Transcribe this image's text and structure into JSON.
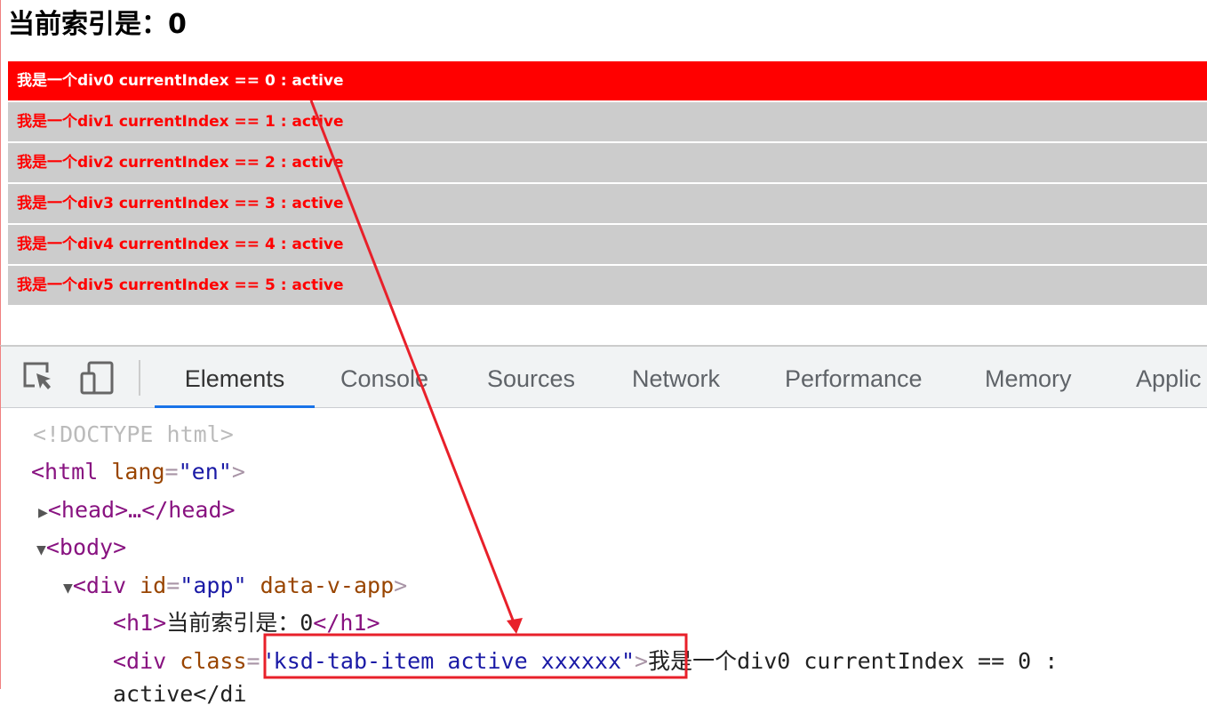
{
  "page": {
    "heading": "当前索引是：0",
    "items": [
      {
        "label": "我是一个div0 currentIndex == 0 : active",
        "active": true
      },
      {
        "label": "我是一个div1 currentIndex == 1 : active",
        "active": false
      },
      {
        "label": "我是一个div2 currentIndex == 2 : active",
        "active": false
      },
      {
        "label": "我是一个div3 currentIndex == 3 : active",
        "active": false
      },
      {
        "label": "我是一个div4 currentIndex == 4 : active",
        "active": false
      },
      {
        "label": "我是一个div5 currentIndex == 5 : active",
        "active": false
      }
    ]
  },
  "devtools": {
    "tools": [
      "inspect-element-icon",
      "device-toolbar-icon"
    ],
    "tabs": [
      "Elements",
      "Console",
      "Sources",
      "Network",
      "Performance",
      "Memory",
      "Applic"
    ],
    "selected_tab": "Elements",
    "accent": "#1a73e8",
    "code": {
      "doctype": "<!DOCTYPE html>",
      "html_open": "<html",
      "lang_attr": "lang",
      "lang_val": "\"en\"",
      "head": "<head>…</head>",
      "body": "<body>",
      "div_open": "<div",
      "id_attr": "id",
      "id_val": "\"app\"",
      "data_attr": "data-v-app",
      "h1_open": "<h1>",
      "h1_text": "当前索引是：0",
      "h1_close": "</h1>",
      "class_attr": "class",
      "class_val": "\"ksd-tab-item active xxxxxx\"",
      "div_text": "我是一个div0 currentIndex == 0 :",
      "cont_text": "active</di"
    }
  },
  "annotation": {
    "color": "#e8202a"
  }
}
